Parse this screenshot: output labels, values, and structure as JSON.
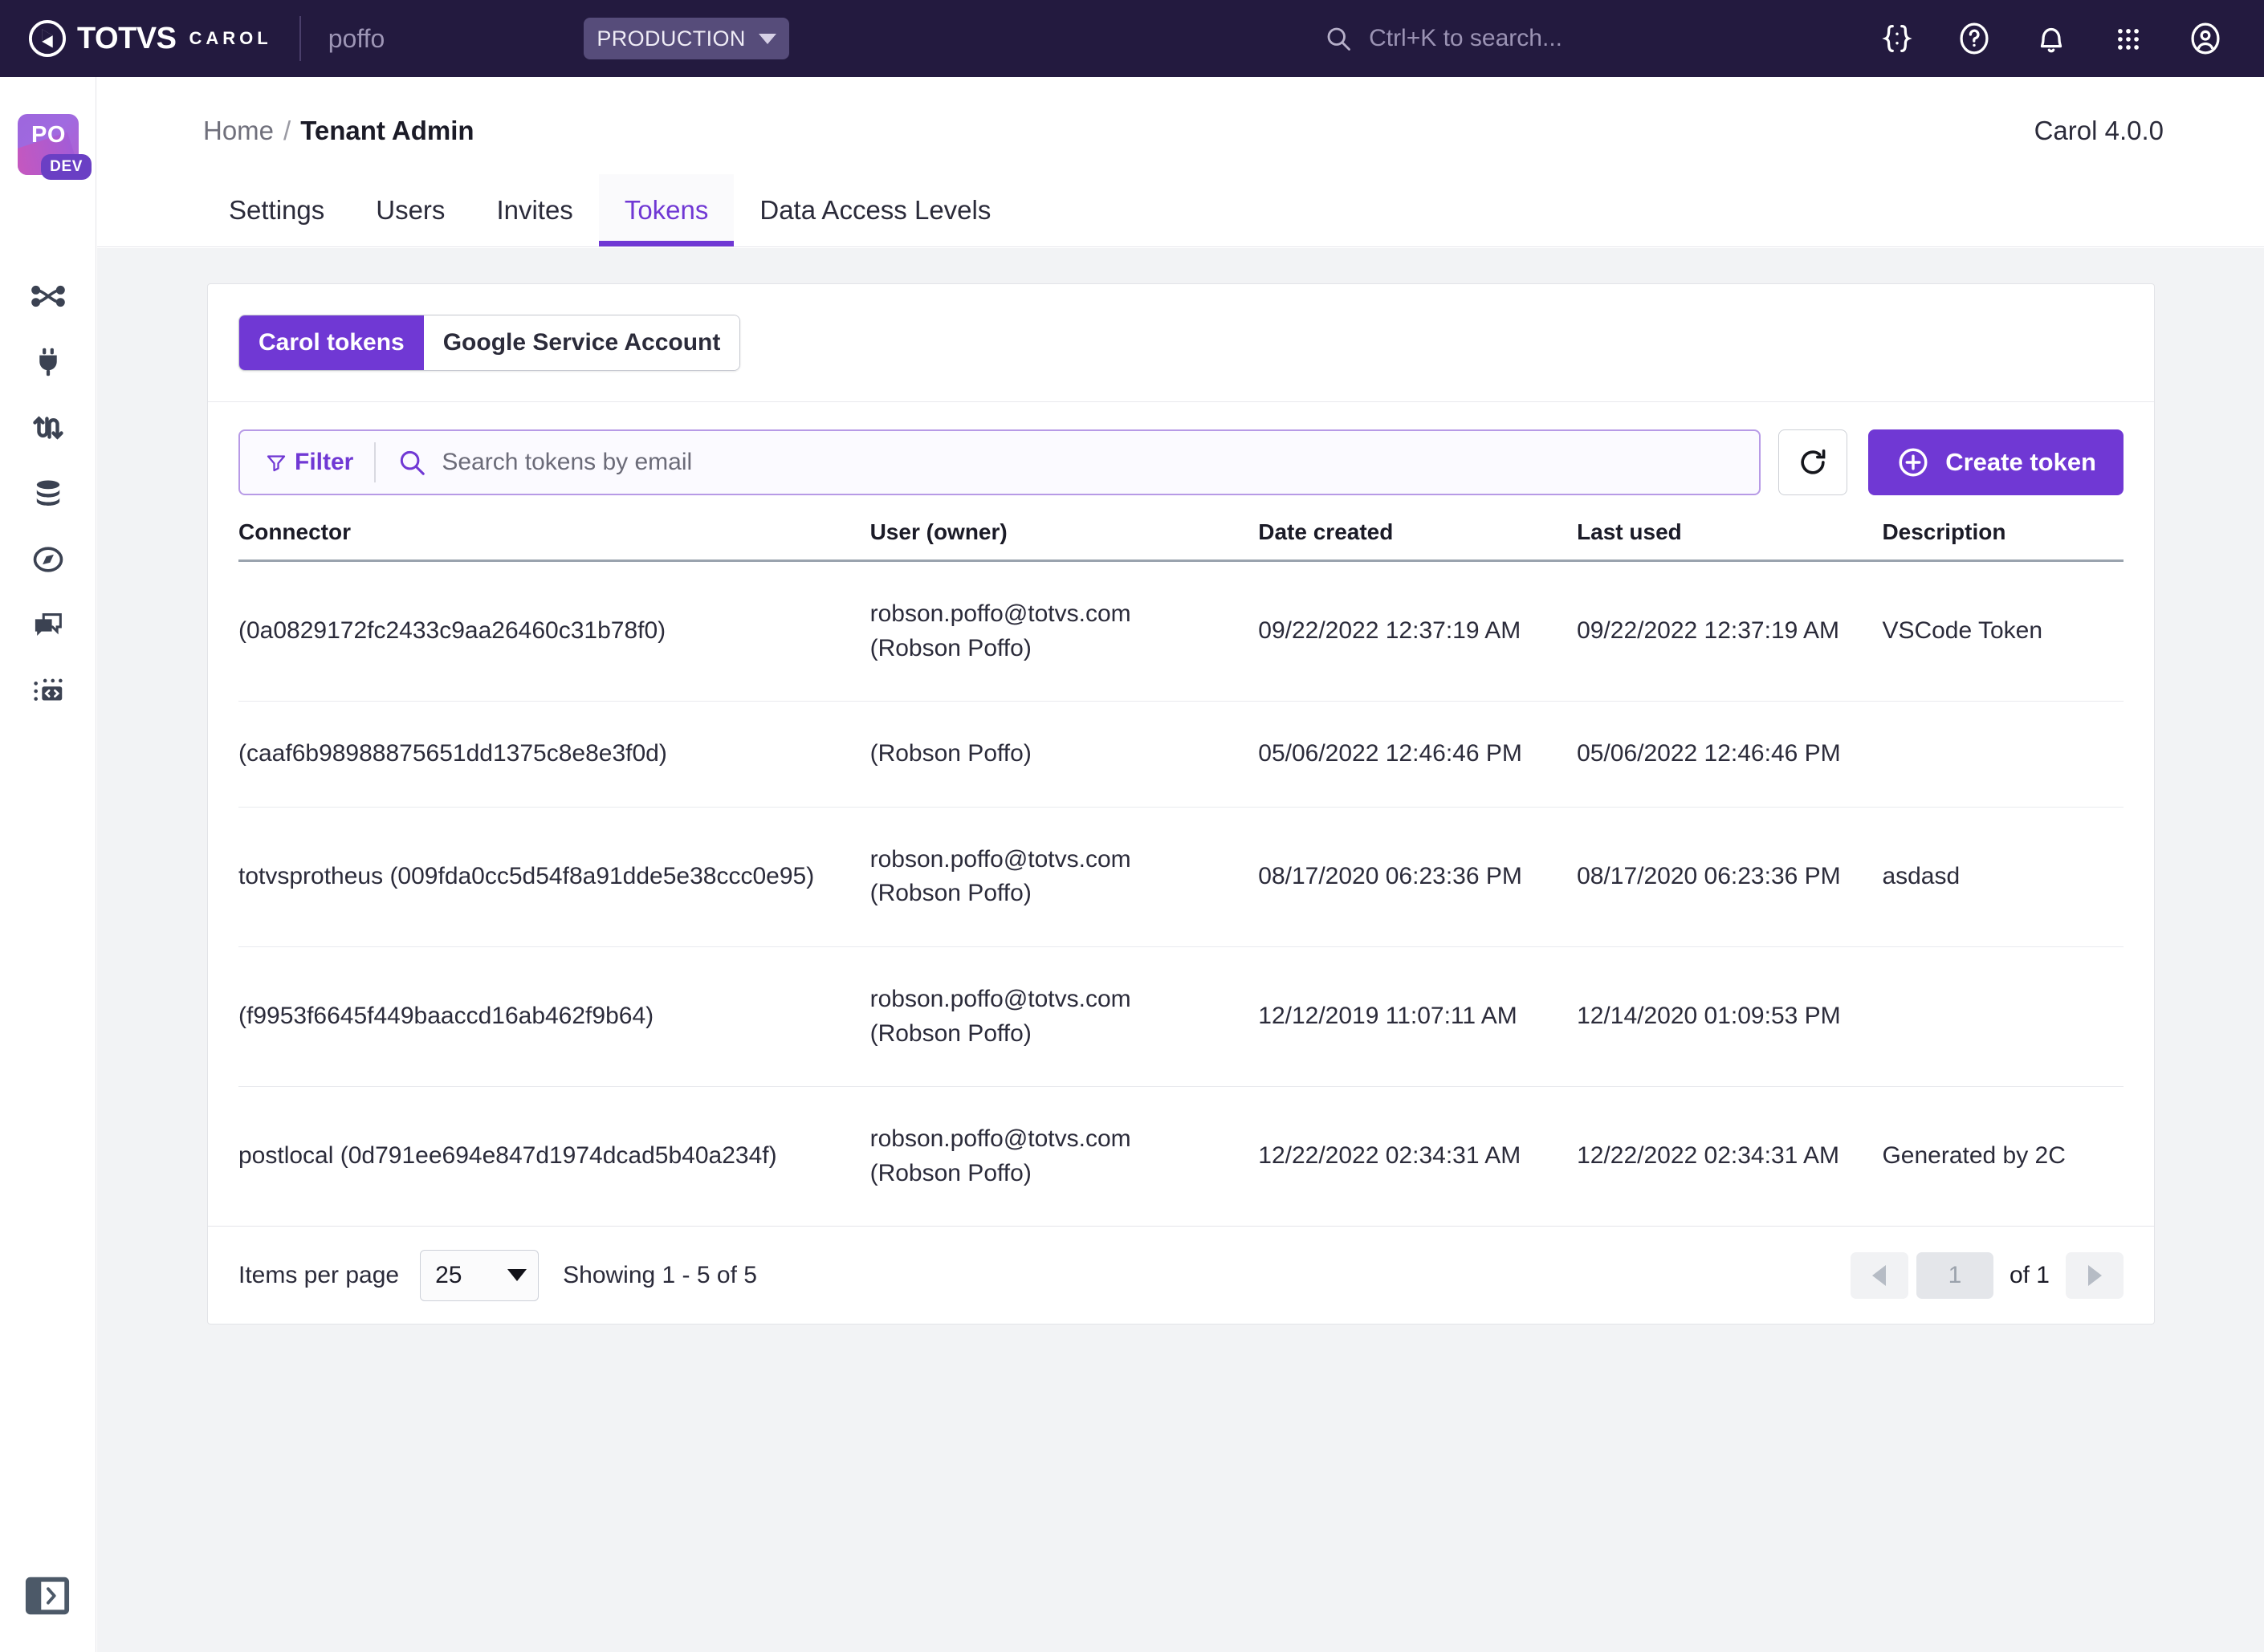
{
  "topbar": {
    "brand_totvs": "TOTVS",
    "brand_carol": "CAROL",
    "tenant": "poffo",
    "environment": "PRODUCTION",
    "search_placeholder": "Ctrl+K to search...",
    "icons": [
      "code-braces-icon",
      "help-circle-icon",
      "bell-icon",
      "apps-grid-icon",
      "user-account-icon"
    ]
  },
  "rail": {
    "avatar_initials": "PO",
    "avatar_badge": "DEV",
    "items": [
      {
        "name": "flows-icon"
      },
      {
        "name": "plug-connector-icon"
      },
      {
        "name": "data-exchange-icon"
      },
      {
        "name": "database-icon"
      },
      {
        "name": "explore-compass-icon"
      },
      {
        "name": "chat-bubbles-icon"
      },
      {
        "name": "code-block-icon"
      }
    ],
    "expand_icon": "expand-sidebar-icon"
  },
  "page": {
    "breadcrumb_home": "Home",
    "breadcrumb_sep": "/",
    "breadcrumb_current": "Tenant Admin",
    "version": "Carol 4.0.0",
    "tabs": [
      {
        "label": "Settings",
        "active": false
      },
      {
        "label": "Users",
        "active": false
      },
      {
        "label": "Invites",
        "active": false
      },
      {
        "label": "Tokens",
        "active": true
      },
      {
        "label": "Data Access Levels",
        "active": false
      }
    ]
  },
  "segmented": {
    "carol_tokens": "Carol tokens",
    "google_service_account": "Google Service Account",
    "selected": "Carol tokens"
  },
  "toolbar": {
    "filter_label": "Filter",
    "search_value": "",
    "search_placeholder": "Search tokens by email",
    "refresh_icon": "refresh-icon",
    "create_label": "Create token",
    "create_icon": "plus-circle-icon"
  },
  "table": {
    "columns": [
      "Connector",
      "User (owner)",
      "Date created",
      "Last used",
      "Description"
    ],
    "rows": [
      {
        "connector": "(0a0829172fc2433c9aa26460c31b78f0)",
        "user": "robson.poffo@totvs.com (Robson Poffo)",
        "date_created": "09/22/2022 12:37:19 AM",
        "last_used": "09/22/2022 12:37:19 AM",
        "description": "VSCode Token"
      },
      {
        "connector": "(caaf6b98988875651dd1375c8e8e3f0d)",
        "user": "(Robson Poffo)",
        "date_created": "05/06/2022 12:46:46 PM",
        "last_used": "05/06/2022 12:46:46 PM",
        "description": ""
      },
      {
        "connector": "totvsprotheus (009fda0cc5d54f8a91dde5e38ccc0e95)",
        "user": "robson.poffo@totvs.com (Robson Poffo)",
        "date_created": "08/17/2020 06:23:36 PM",
        "last_used": "08/17/2020 06:23:36 PM",
        "description": "asdasd"
      },
      {
        "connector": "(f9953f6645f449baaccd16ab462f9b64)",
        "user": "robson.poffo@totvs.com (Robson Poffo)",
        "date_created": "12/12/2019 11:07:11 AM",
        "last_used": "12/14/2020 01:09:53 PM",
        "description": ""
      },
      {
        "connector": "postlocal (0d791ee694e847d1974dcad5b40a234f)",
        "user": "robson.poffo@totvs.com (Robson Poffo)",
        "date_created": "12/22/2022 02:34:31 AM",
        "last_used": "12/22/2022 02:34:31 AM",
        "description": "Generated by 2C"
      }
    ]
  },
  "footer": {
    "items_per_page_label": "Items per page",
    "items_per_page_value": "25",
    "showing": "Showing 1 - 5 of 5",
    "page_value": "1",
    "of_label": "of 1"
  },
  "colors": {
    "accent_purple": "#7038d4",
    "topbar_bg": "#231a3f",
    "content_bg": "#f2f3f5",
    "text_dark": "#1b1b27"
  }
}
